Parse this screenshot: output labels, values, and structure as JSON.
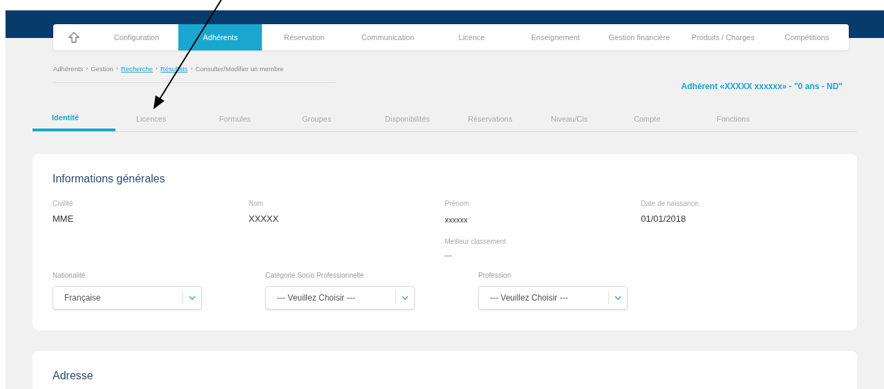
{
  "nav": [
    {
      "label": "Configuration",
      "selected": false
    },
    {
      "label": "Adhérents",
      "selected": true
    },
    {
      "label": "Réservation",
      "selected": false
    },
    {
      "label": "Communication",
      "selected": false
    },
    {
      "label": "Licence",
      "selected": false
    },
    {
      "label": "Enseignement",
      "selected": false
    },
    {
      "label": "Gestion financière",
      "selected": false
    },
    {
      "label": "Produits / Charges",
      "selected": false
    },
    {
      "label": "Compétitions",
      "selected": false
    }
  ],
  "breadcrumb_separator": "›",
  "breadcrumb": [
    {
      "label": "Adhérents",
      "link": false
    },
    {
      "label": "Gestion",
      "link": false
    },
    {
      "label": "Recherche",
      "link": true
    },
    {
      "label": "Résultats",
      "link": true
    },
    {
      "label": "Consulter/Modifier un membre",
      "link": false
    }
  ],
  "member_title": "Adhérent «XXXXX xxxxxx» - \"0 ans - ND\"",
  "tabs": [
    {
      "label": "Identité",
      "selected": true
    },
    {
      "label": "Licences",
      "selected": false
    },
    {
      "label": "Formules",
      "selected": false
    },
    {
      "label": "Groupes",
      "selected": false
    },
    {
      "label": "Disponibilités",
      "selected": false
    },
    {
      "label": "Réservations",
      "selected": false
    },
    {
      "label": "Niveau/Cls",
      "selected": false
    },
    {
      "label": "Compte",
      "selected": false
    },
    {
      "label": "Fonctions",
      "selected": false
    }
  ],
  "general": {
    "title": "Informations générales",
    "fields": [
      {
        "label": "Civilité",
        "value": "MME"
      },
      {
        "label": "Nom",
        "value": "XXXXX"
      },
      {
        "label": "Prénom",
        "value": "xxxxxx"
      },
      {
        "label": "Date de naissance",
        "value": "01/01/2018"
      }
    ],
    "best_ranking": {
      "label": "Meilleur classement",
      "value": "---"
    },
    "selects": [
      {
        "label": "Nationalité",
        "value": "Française"
      },
      {
        "label": "Catégorie Socio Professionnelle",
        "value": "--- Veuillez Choisir ---"
      },
      {
        "label": "Profession",
        "value": "--- Veuillez Choisir ---"
      }
    ]
  },
  "address": {
    "title": "Adresse"
  }
}
